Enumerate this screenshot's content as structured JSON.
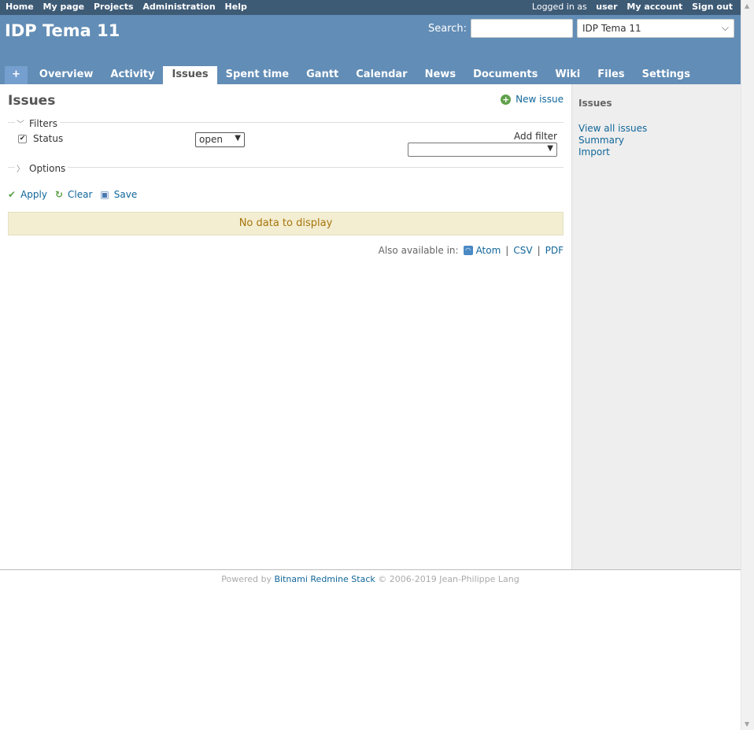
{
  "top_menu": {
    "left": [
      "Home",
      "My page",
      "Projects",
      "Administration",
      "Help"
    ],
    "logged_in_prefix": "Logged in as",
    "user": "user",
    "my_account": "My account",
    "sign_out": "Sign out"
  },
  "header": {
    "title": "IDP Tema 11",
    "search_label": "Search:",
    "search_value": "",
    "project_jump": "IDP Tema 11"
  },
  "main_menu": {
    "plus": "+",
    "tabs": [
      "Overview",
      "Activity",
      "Issues",
      "Spent time",
      "Gantt",
      "Calendar",
      "News",
      "Documents",
      "Wiki",
      "Files",
      "Settings"
    ],
    "selected": "Issues"
  },
  "content": {
    "title": "Issues",
    "new_issue": "New issue",
    "filters_legend": "Filters",
    "status_label": "Status",
    "status_checked": true,
    "status_operator": "open",
    "add_filter_label": "Add filter",
    "add_filter_value": "",
    "options_legend": "Options",
    "apply": "Apply",
    "clear": "Clear",
    "save": "Save",
    "no_data": "No data to display",
    "also_available": "Also available in:",
    "formats": [
      "Atom",
      "CSV",
      "PDF"
    ]
  },
  "sidebar": {
    "heading": "Issues",
    "links": [
      "View all issues",
      "Summary",
      "Import"
    ]
  },
  "footer": {
    "powered_by": "Powered by",
    "link": "Bitnami Redmine Stack",
    "copyright": "© 2006-2019 Jean-Philippe Lang"
  },
  "colors": {
    "top_menu_bg": "#3e5b76",
    "header_bg": "#628db6",
    "link": "#169",
    "nodata_bg": "#f3edd1"
  },
  "icons": {
    "new_issue": "add-circle-icon",
    "apply": "checkmark-icon",
    "clear": "reload-icon",
    "save": "floppy-disk-icon",
    "atom": "feed-icon"
  }
}
